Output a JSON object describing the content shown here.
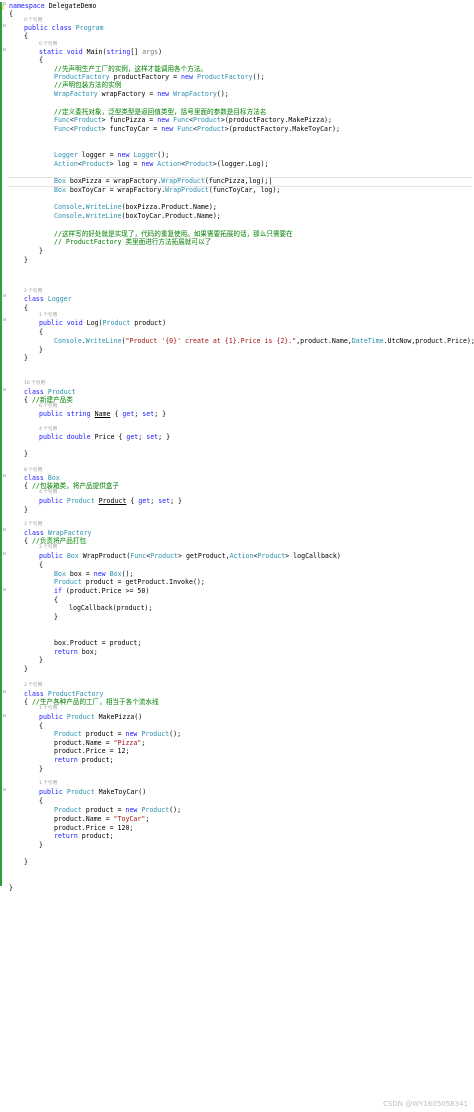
{
  "refs": {
    "r0": "0 个引用",
    "r2": "2 个引用",
    "r1": "1 个引用",
    "r16": "16 个引用",
    "r6": "6 个引用",
    "r4": "4 个引用",
    "r8": "8 个引用"
  },
  "lines": {
    "ns": "namespace DelegateDemo",
    "ob": "{",
    "cb": "}",
    "program": "public class Program",
    "main": "static void Main(string[] args)",
    "c1": "//先声明生产工厂的实例，这样才能调用各个方法。",
    "l_pf": "ProductFactory productFactory = new ProductFactory();",
    "c2": "//声明包装方法的实例",
    "l_wf": "WrapFactory wrapFactory = new WrapFactory();",
    "c3": "//定义委托对象，泛型类型是返回值类型，括号里面的参数是目标方法名",
    "l_fp": "Func<Product> funcPizza = new Func<Product>(productFactory.MakePizza);",
    "l_ft": "Func<Product> funcToyCar = new Func<Product>(productFactory.MakeToyCar);",
    "l_lg": "Logger logger = new Logger();",
    "l_act": "Action<Product> log = new Action<Product>(logger.Log);",
    "l_bp": "Box boxPizza = wrapFactory.WrapProduct(funcPizza,log);",
    "l_bt": "Box boxToyCar = wrapFactory.WrapProduct(funcToyCar, log);",
    "l_w1": "Console.WriteLine(boxPizza.Product.Name);",
    "l_w2": "Console.WriteLine(boxToyCar.Product.Name);",
    "c4": "//这样写的好处就是实现了，代码的重复使用。如果需要拓展的话，那么只需要在",
    "c5": "// ProductFactory 类里面进行方法拓展就可以了",
    "logger": "class Logger",
    "log": "public void Log(Product product)",
    "log_body": "Console.WriteLine(\"Product '{0}' create at {1}.Price is {2}.\",product.Name,DateTime.UtcNow,product.Price);",
    "product": "class Product",
    "prod_ob": "{ //新建产品类",
    "name_prop": "public string Name { get; set; }",
    "price_prop": "public double Price { get; set; }",
    "box": "class Box",
    "box_ob": "{ //包装箱类，将产品提供盒子",
    "box_prop": "public Product Product { get; set; }",
    "wrapf": "class WrapFactory",
    "wrapf_ob": "{ //负责将产品打包",
    "wrapp": "public Box WrapProduct(Func<Product> getProduct,Action<Product> logCallback)",
    "w_box": "Box box = new Box();",
    "w_prod": "Product product = getProduct.Invoke();",
    "w_if": "if (product.Price >= 50)",
    "w_cb": "logCallback(product);",
    "w_assign": "box.Product = product;",
    "w_ret": "return box;",
    "pf": "class ProductFactory",
    "pf_ob": "{ //生产各种产品的工厂，相当于各个流水线",
    "mp": "public Product MakePizza()",
    "mp_new": "Product product = new Product();",
    "mp_name": "product.Name = \"Pizza\";",
    "mp_price": "product.Price = 12;",
    "ret_prod": "return product;",
    "mt": "public Product MakeToyCar()",
    "mt_name": "product.Name = \"ToyCar\";",
    "mt_price": "product.Price = 120;"
  },
  "watermark": "CSDN @WY1605058341",
  "colors": {
    "keyword": "#1a1aff",
    "type": "#2b91af",
    "comment": "#008000",
    "string": "#a31515",
    "change_bar": "#2e9e3e",
    "reference": "#9a9a9a"
  }
}
